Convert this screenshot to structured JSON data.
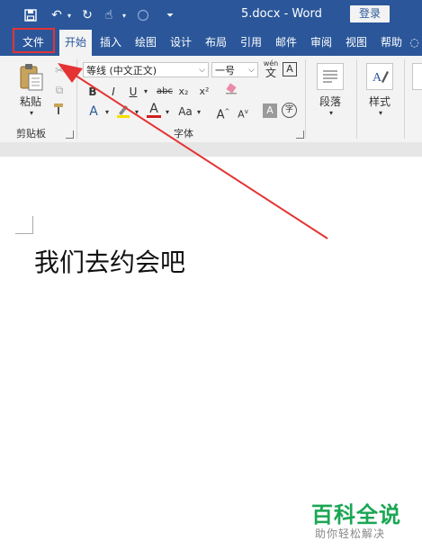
{
  "titlebar": {
    "doc_title": "5.docx  -  Word",
    "login": "登录"
  },
  "tabs": [
    {
      "label": "文件"
    },
    {
      "label": "开始"
    },
    {
      "label": "插入"
    },
    {
      "label": "绘图"
    },
    {
      "label": "设计"
    },
    {
      "label": "布局"
    },
    {
      "label": "引用"
    },
    {
      "label": "邮件"
    },
    {
      "label": "审阅"
    },
    {
      "label": "视图"
    },
    {
      "label": "帮助"
    }
  ],
  "ribbon": {
    "paste_label": "粘贴",
    "clipboard_label": "剪贴板",
    "font_name": "等线 (中文正文)",
    "font_size": "一号",
    "font_group_label": "字体",
    "paragraph_label": "段落",
    "styles_label": "样式",
    "wen_label": "wén",
    "bold": "B",
    "italic": "I",
    "underline": "U",
    "strike": "abc",
    "subscript": "x₂",
    "superscript": "x²",
    "font_color": "A",
    "change_case": "Aa",
    "grow": "A",
    "shrink": "A",
    "char_border": "A",
    "enclose": "字"
  },
  "document": {
    "text": "我们去约会吧"
  },
  "watermark": {
    "title": "百科全说",
    "subtitle": "助你轻松解决"
  },
  "colors": {
    "brand": "#2b579a",
    "highlight_box": "#e53333",
    "watermark": "#1aa654"
  }
}
